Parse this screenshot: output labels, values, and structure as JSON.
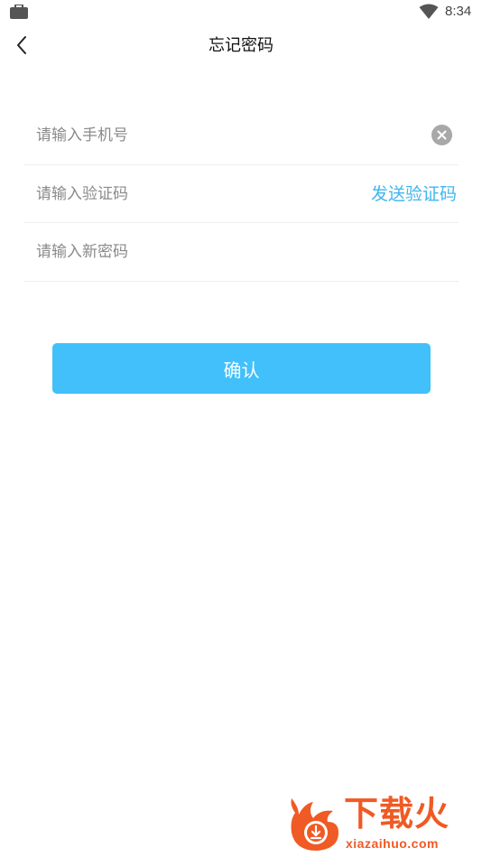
{
  "status_bar": {
    "time": "8:34",
    "left_icon": "briefcase-icon",
    "right_icon": "wifi-icon"
  },
  "nav": {
    "title": "忘记密码",
    "back_icon": "chevron-left-icon"
  },
  "form": {
    "phone_placeholder": "请输入手机号",
    "phone_value": "",
    "code_placeholder": "请输入验证码",
    "code_value": "",
    "send_code_label": "发送验证码",
    "password_placeholder": "请输入新密码",
    "password_value": ""
  },
  "confirm_label": "确认",
  "watermark": {
    "name": "下载火",
    "domain": "xiazaihuo.com"
  },
  "colors": {
    "accent": "#42c0fb",
    "link": "#3fb6ef",
    "watermark": "#f05a24"
  }
}
